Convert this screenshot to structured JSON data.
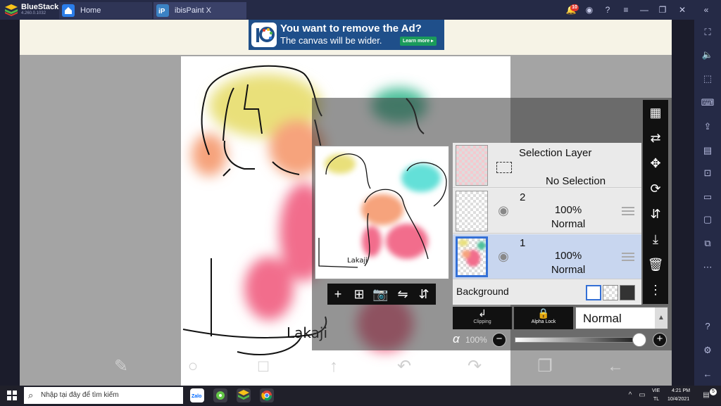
{
  "titlebar": {
    "app_name": "BlueStacks",
    "version": "4.260.0.1032",
    "tabs": [
      {
        "label": "Home",
        "icon": "home-icon",
        "color": "#2b7de9"
      },
      {
        "label": "ibisPaint X",
        "icon": "ibispaint-icon",
        "color": "#3b82c4"
      }
    ],
    "notification_count": "10"
  },
  "ad": {
    "title": "You want to remove the Ad?",
    "subtitle": "The canvas will be wider.",
    "button": "Learn more ▸"
  },
  "canvas": {
    "signature_text": "Lakaji",
    "colors": {
      "yellow": "#e9e07a",
      "orange": "#f6a37b",
      "pink": "#f26d8c",
      "green": "#4bbf9a",
      "cyan": "#63e0d8"
    }
  },
  "layers": {
    "selection": {
      "name": "Selection Layer",
      "status": "No Selection"
    },
    "items": [
      {
        "name": "2",
        "opacity": "100%",
        "blend": "Normal"
      },
      {
        "name": "1",
        "opacity": "100%",
        "blend": "Normal"
      }
    ],
    "background_label": "Background"
  },
  "blend": {
    "clipping_label": "Clipping",
    "alpha_lock_label": "Alpha Lock",
    "mode": "Normal"
  },
  "alpha": {
    "symbol": "α",
    "value": "100%"
  },
  "taskbar": {
    "search_placeholder": "Nhập tại đây để tìm kiếm",
    "lang_top": "VIE",
    "lang_bottom": "TL",
    "time": "4:21 PM",
    "date": "10/4/2021",
    "notification_count": "5"
  }
}
